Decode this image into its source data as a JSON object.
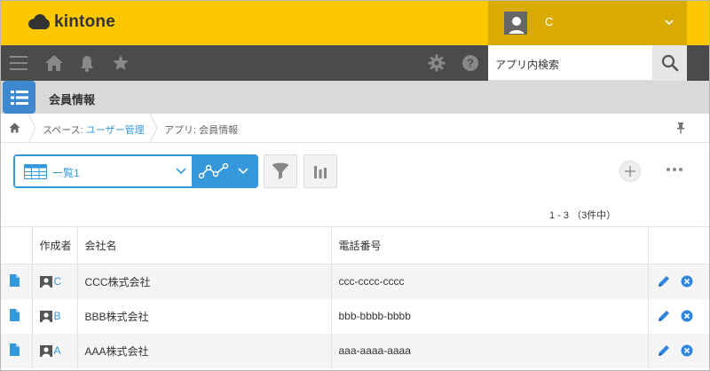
{
  "header": {
    "logo_text": "kintone",
    "user_name": "C"
  },
  "navbar": {
    "search_placeholder": "アプリ内検索"
  },
  "app": {
    "title": "会員情報"
  },
  "breadcrumb": {
    "space_prefix": "スペース: ",
    "space_name": "ユーザー管理",
    "app_crumb": "アプリ: 会員情報"
  },
  "toolbar": {
    "view_name": "一覧1",
    "paging": "1 - 3 （3件中）"
  },
  "table": {
    "headers": {
      "creator": "作成者",
      "company": "会社名",
      "phone": "電話番号"
    },
    "rows": [
      {
        "creator": "C",
        "company": "CCC株式会社",
        "phone": "ccc-cccc-cccc"
      },
      {
        "creator": "B",
        "company": "BBB株式会社",
        "phone": "bbb-bbbb-bbbb"
      },
      {
        "creator": "A",
        "company": "AAA株式会社",
        "phone": "aaa-aaaa-aaaa"
      }
    ]
  },
  "colors": {
    "brand_yellow": "#fcc800",
    "user_area": "#d9aa00",
    "nav_dark": "#4b4b4b",
    "accent_blue": "#3498db",
    "delete_blue": "#2e86de"
  },
  "icons": {
    "menu": "hamburger-icon",
    "home": "home-icon",
    "notifications": "bell-icon",
    "favorites": "star-icon",
    "settings": "gear-icon",
    "help": "help-icon",
    "search": "search-icon",
    "pin": "pin-icon",
    "view": "list-view-icon",
    "graph": "line-graph-icon",
    "filter": "filter-icon",
    "chart": "bar-chart-icon",
    "add": "plus-icon",
    "more": "more-icon",
    "record": "document-icon",
    "edit": "pencil-icon",
    "delete": "close-circle-icon"
  }
}
